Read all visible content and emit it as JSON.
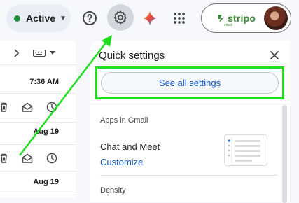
{
  "topbar": {
    "status_label": "Active",
    "brand_name": "stripo",
    "brand_sub": "email"
  },
  "mail_list": {
    "rows": [
      {
        "time": "7:36 AM"
      },
      {
        "time": "Aug 19"
      },
      {
        "time": "Aug 19"
      }
    ]
  },
  "quick_settings": {
    "title": "Quick settings",
    "see_all_label": "See all settings",
    "apps_heading": "Apps in Gmail",
    "chat_meet_label": "Chat and Meet",
    "customize_label": "Customize",
    "density_heading": "Density"
  },
  "colors": {
    "accent": "#0b57d0",
    "status_green": "#1e8e3e",
    "annotation": "#1fe01f"
  }
}
